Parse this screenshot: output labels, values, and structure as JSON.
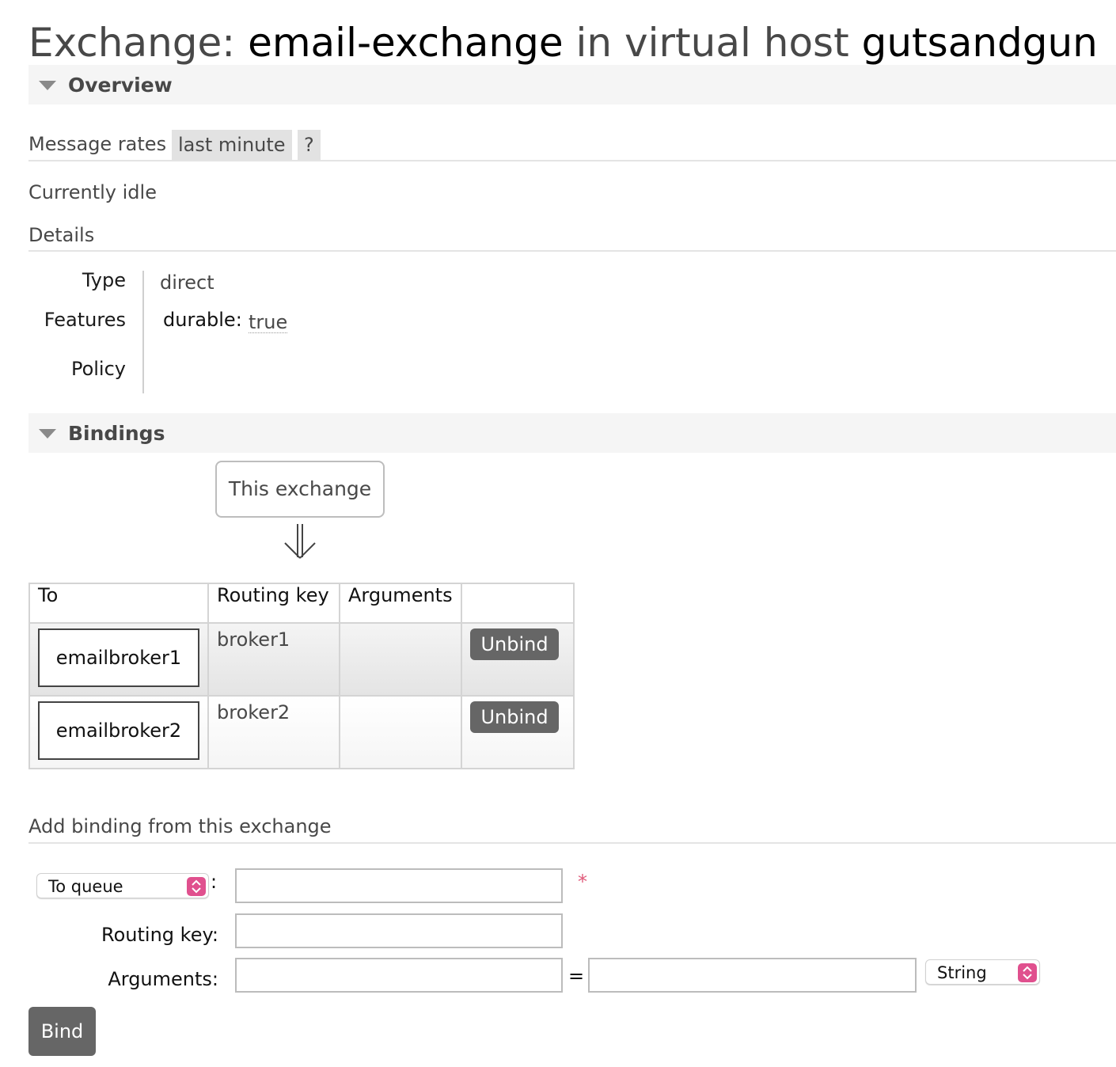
{
  "header": {
    "prefix": "Exchange:",
    "exchange_name": "email-exchange",
    "middle": "in virtual host",
    "vhost": "gutsandgun"
  },
  "overview": {
    "section_label": "Overview",
    "message_rates_label": "Message rates",
    "rate_period": "last minute",
    "help": "?",
    "status": "Currently idle",
    "details_label": "Details",
    "details": {
      "type_label": "Type",
      "type_value": "direct",
      "features_label": "Features",
      "durable_label": "durable:",
      "durable_value": "true",
      "policy_label": "Policy"
    }
  },
  "bindings": {
    "section_label": "Bindings",
    "source_box": "This exchange",
    "columns": [
      "To",
      "Routing key",
      "Arguments",
      ""
    ],
    "rows": [
      {
        "to": "emailbroker1",
        "routing_key": "broker1",
        "arguments": "",
        "action": "Unbind"
      },
      {
        "to": "emailbroker2",
        "routing_key": "broker2",
        "arguments": "",
        "action": "Unbind"
      }
    ]
  },
  "add_binding": {
    "title": "Add binding from this exchange",
    "destination_type": "To queue",
    "colon": ":",
    "required_mark": "*",
    "routing_key_label": "Routing key:",
    "arguments_label": "Arguments:",
    "equals": "=",
    "arg_type": "String",
    "bind_button": "Bind",
    "destination_value": "",
    "routing_key_value": "",
    "arg_key_value": "",
    "arg_value_value": ""
  }
}
